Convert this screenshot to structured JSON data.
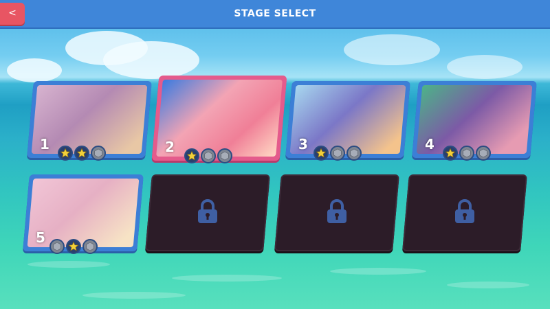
{
  "header": {
    "title": "STAGE SELECT",
    "back_label": "<"
  },
  "stages": [
    {
      "number": "1",
      "stars": [
        true,
        true,
        false
      ],
      "locked": false,
      "selected": false
    },
    {
      "number": "2",
      "stars": [
        true,
        false,
        false
      ],
      "locked": false,
      "selected": true
    },
    {
      "number": "3",
      "stars": [
        true,
        false,
        false
      ],
      "locked": false,
      "selected": false
    },
    {
      "number": "4",
      "stars": [
        true,
        false,
        false
      ],
      "locked": false,
      "selected": false
    },
    {
      "number": "5",
      "stars": [
        false,
        true,
        false
      ],
      "locked": false,
      "selected": false
    },
    {
      "number": "",
      "stars": [],
      "locked": true,
      "icon": "padlock-icon"
    },
    {
      "number": "",
      "stars": [],
      "locked": true,
      "icon": "padlock-icon"
    },
    {
      "number": "",
      "stars": [],
      "locked": true,
      "icon": "padlock-icon"
    }
  ],
  "colors": {
    "topbar": "#3f86d9",
    "back": "#e85563",
    "card_frame": "#3c7fd6",
    "selected_frame": "#e45b8c",
    "locked": "#2c1c28",
    "star_gold": "#f2d03b"
  }
}
